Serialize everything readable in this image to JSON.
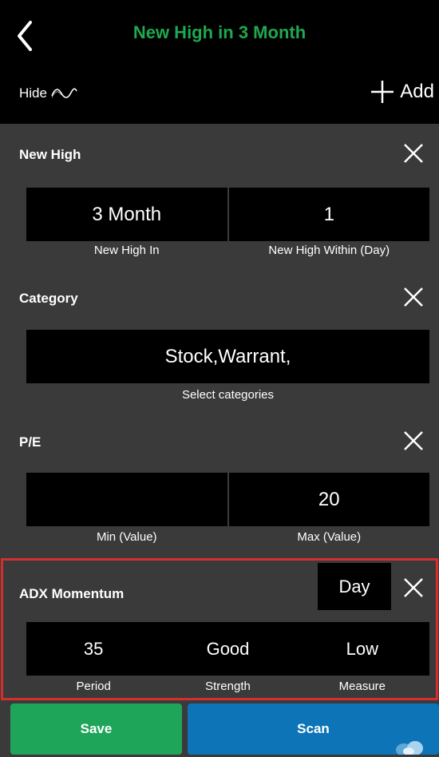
{
  "header": {
    "title": "New High in 3 Month",
    "hide_label": "Hide",
    "add_label": "Add",
    "title_color": "#1fa84f"
  },
  "sections": [
    {
      "title": "New High",
      "fields": [
        {
          "value": "3 Month",
          "caption": "New High In"
        },
        {
          "value": "1",
          "caption": "New High Within (Day)"
        }
      ]
    },
    {
      "title": "Category",
      "fields": [
        {
          "value": "Stock,Warrant,",
          "caption": "Select categories"
        }
      ]
    },
    {
      "title": "P/E",
      "fields": [
        {
          "value": "",
          "caption": "Min (Value)"
        },
        {
          "value": "20",
          "caption": "Max (Value)"
        }
      ]
    },
    {
      "title": "ADX Momentum",
      "period_select": "Day",
      "fields": [
        {
          "value": "35",
          "caption": "Period"
        },
        {
          "value": "Good",
          "caption": "Strength"
        },
        {
          "value": "Low",
          "caption": "Measure"
        }
      ],
      "highlight_color": "#d32f2f"
    }
  ],
  "footer": {
    "save_label": "Save",
    "scan_label": "Scan",
    "save_color": "#1fa55a",
    "scan_color": "#0d74b8"
  },
  "icons": [
    "back-arrow-icon",
    "wave-icon",
    "plus-icon",
    "close-icon",
    "hand-pointer-icon"
  ]
}
